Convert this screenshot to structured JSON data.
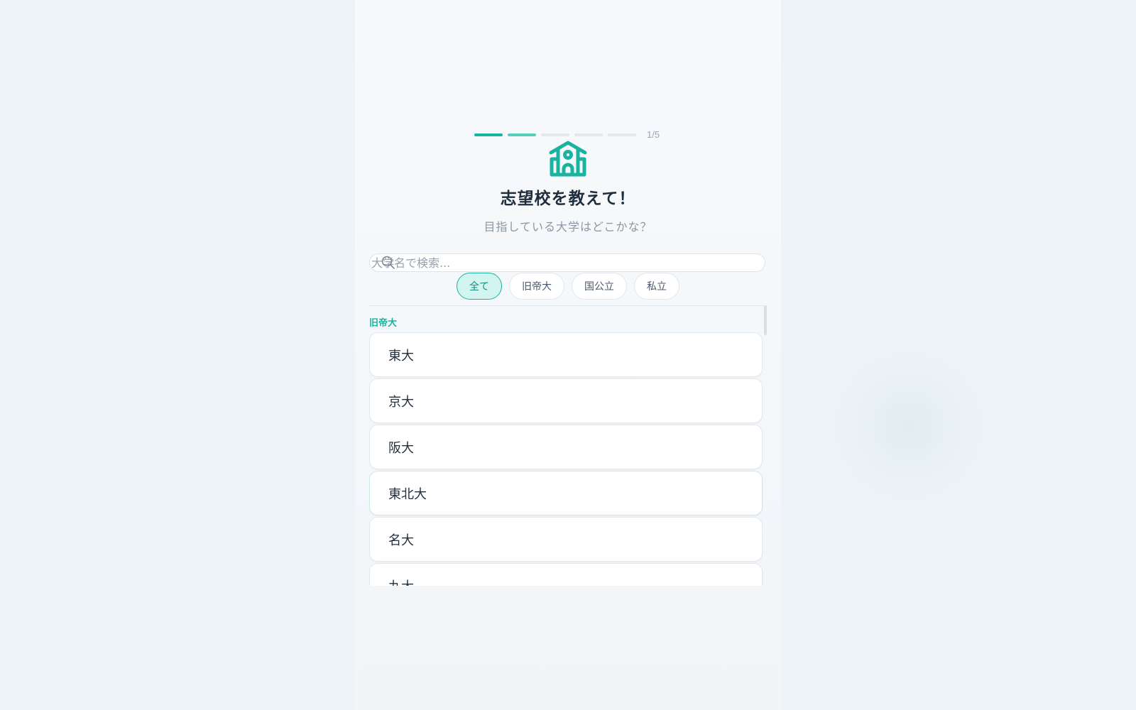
{
  "progress": {
    "total_steps": 5,
    "current_step": 1,
    "label": "1/5"
  },
  "header": {
    "icon": "school-icon",
    "title": "志望校を教えて！",
    "subtitle": "目指している大学はどこかな？"
  },
  "search": {
    "placeholder": "大学名で検索...",
    "value": ""
  },
  "filters": [
    {
      "label": "全て",
      "active": true
    },
    {
      "label": "旧帝大",
      "active": false
    },
    {
      "label": "国公立",
      "active": false
    },
    {
      "label": "私立",
      "active": false
    }
  ],
  "list": {
    "group_label": "旧帝大",
    "items": [
      "東大",
      "京大",
      "阪大",
      "東北大",
      "名大",
      "九大"
    ]
  },
  "colors": {
    "accent": "#1ab39f",
    "accent_light": "#d3f5ef",
    "text": "#1f2d3d",
    "muted": "#8a96a3"
  }
}
